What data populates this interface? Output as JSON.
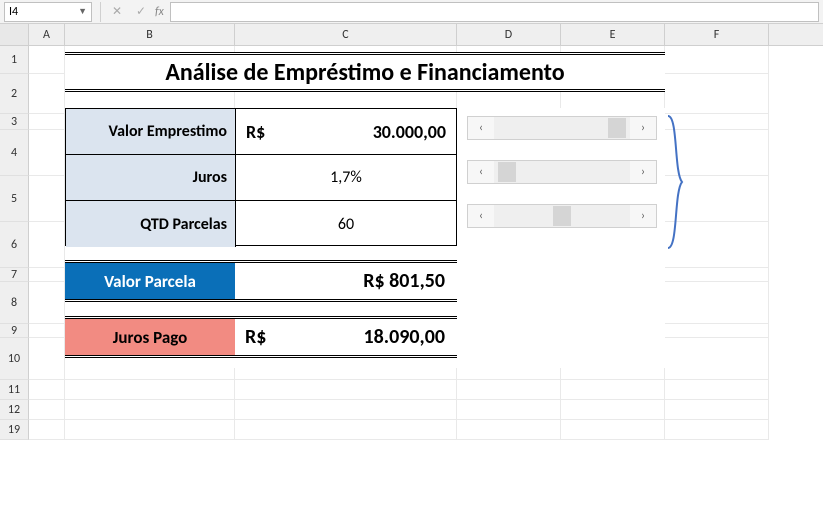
{
  "name_box": {
    "value": "I4"
  },
  "col_headers": [
    "A",
    "B",
    "C",
    "D",
    "E",
    "F"
  ],
  "row_headers": [
    "1",
    "2",
    "3",
    "4",
    "5",
    "6",
    "7",
    "8",
    "9",
    "10",
    "11",
    "12",
    "19"
  ],
  "title": "Análise de Empréstimo e Financiamento",
  "inputs": {
    "valor_emprestimo": {
      "label": "Valor Emprestimo",
      "currency": "R$",
      "value": "30.000,00"
    },
    "juros": {
      "label": "Juros",
      "value": "1,7%"
    },
    "qtd_parcelas": {
      "label": "QTD Parcelas",
      "value": "60"
    }
  },
  "scrollbars": {
    "valor": {
      "position": "right"
    },
    "juros": {
      "position": "left"
    },
    "parcelas": {
      "position": "mid"
    },
    "arrow_left": "‹",
    "arrow_right": "›"
  },
  "results": {
    "valor_parcela": {
      "label": "Valor Parcela",
      "value": "R$ 801,50"
    },
    "juros_pago": {
      "label": "Juros Pago",
      "currency": "R$",
      "value": "18.090,00"
    }
  },
  "colors": {
    "header_fill": "#dbe4ef",
    "blue": "#0a6fb8",
    "red": "#f28b82",
    "brace": "#4472c4"
  }
}
